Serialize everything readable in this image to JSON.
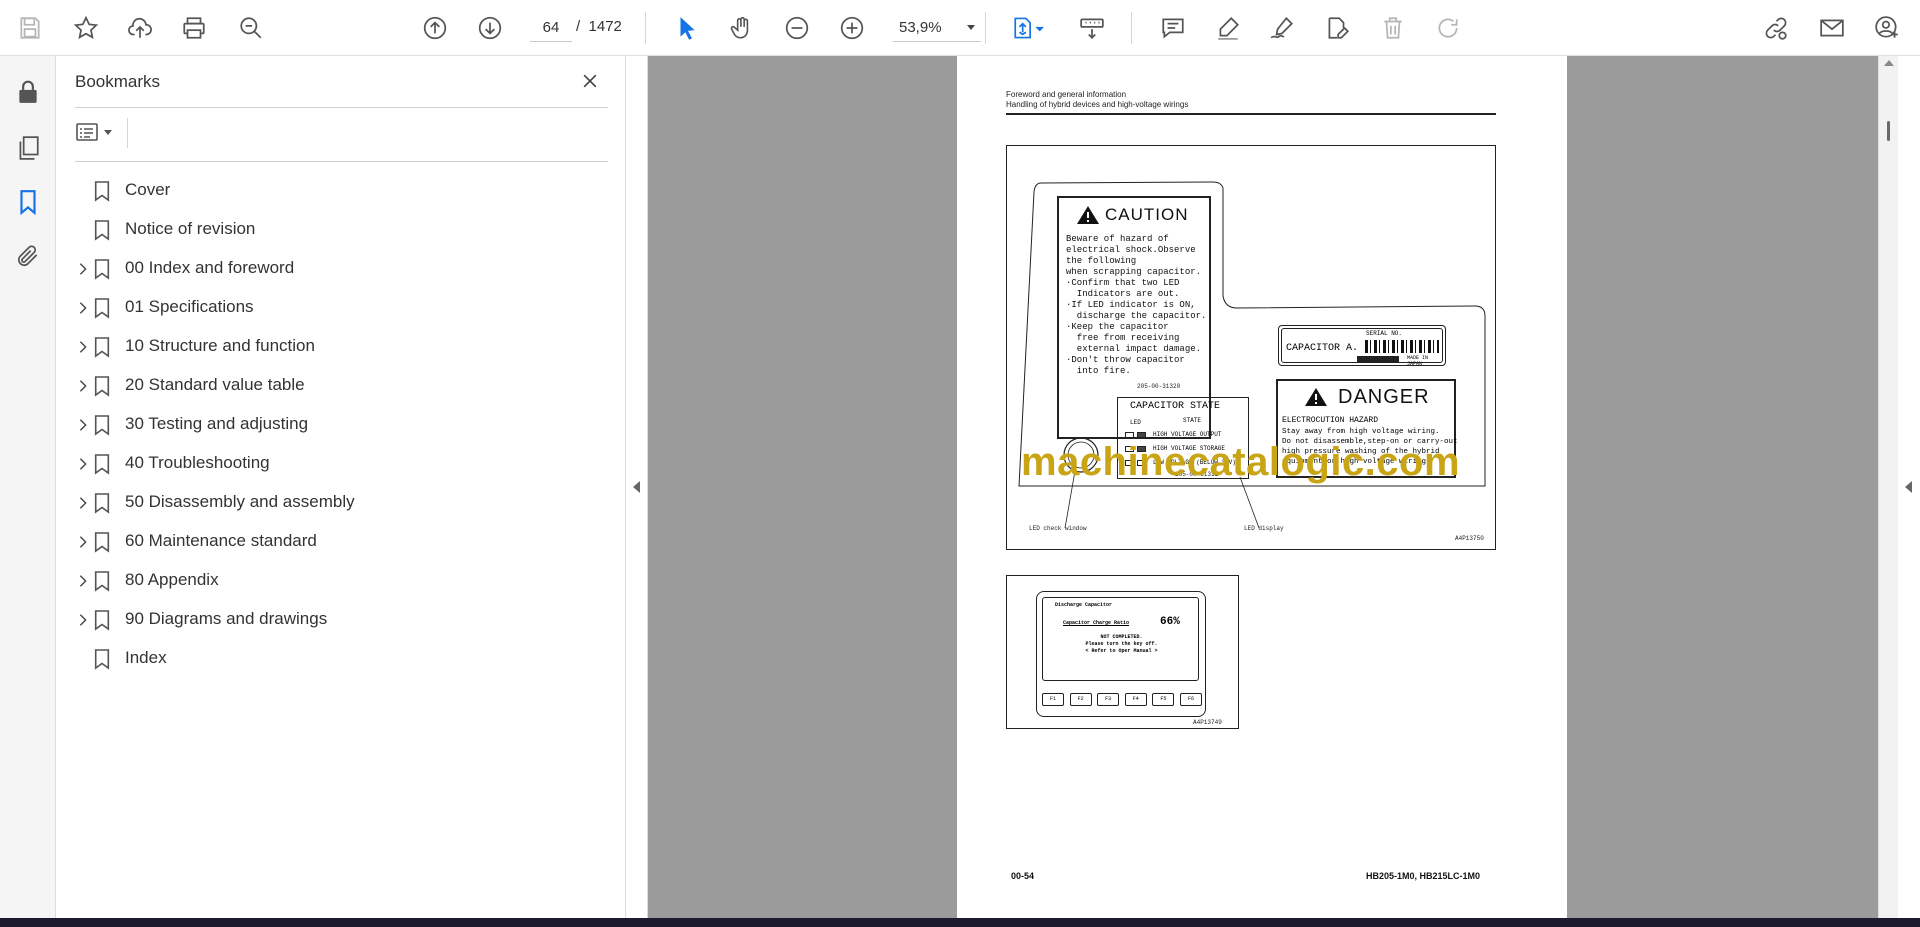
{
  "toolbar": {
    "page_current": "64",
    "page_total": "1472",
    "page_separator": "/",
    "zoom": "53,9%",
    "icons": [
      "save-icon",
      "star-icon",
      "upload-icon",
      "print-icon",
      "search-zoom-icon",
      "page-up-icon",
      "page-down-icon",
      "select-arrow-icon",
      "hand-icon",
      "zoom-out-icon",
      "zoom-in-icon",
      "fit-page-icon",
      "scroll-mode-icon",
      "comment-icon",
      "highlight-icon",
      "sign-icon",
      "edit-doc-icon",
      "delete-icon",
      "redo-icon",
      "share-link-icon",
      "email-icon",
      "account-icon"
    ]
  },
  "left_rail": {
    "icons": [
      "lock-icon",
      "pages-icon",
      "bookmark-icon",
      "attachment-icon"
    ]
  },
  "bookmarks": {
    "title": "Bookmarks",
    "items": [
      {
        "label": "Cover",
        "expandable": false
      },
      {
        "label": "Notice of revision",
        "expandable": false
      },
      {
        "label": "00 Index and foreword",
        "expandable": true
      },
      {
        "label": "01 Specifications",
        "expandable": true
      },
      {
        "label": "10 Structure and function",
        "expandable": true
      },
      {
        "label": "20 Standard value table",
        "expandable": true
      },
      {
        "label": "30 Testing and adjusting",
        "expandable": true
      },
      {
        "label": "40 Troubleshooting",
        "expandable": true
      },
      {
        "label": "50 Disassembly and assembly",
        "expandable": true
      },
      {
        "label": "60 Maintenance standard",
        "expandable": true
      },
      {
        "label": "80 Appendix",
        "expandable": true
      },
      {
        "label": "90 Diagrams and drawings",
        "expandable": true
      },
      {
        "label": "Index",
        "expandable": false
      }
    ]
  },
  "document": {
    "header_line1": "Foreword and general information",
    "header_line2": "Handling of hybrid devices and high-voltage wirings",
    "figure1": {
      "caution_title": "CAUTION",
      "caution_lines": [
        "Beware of hazard of",
        "electrical shock.Observe",
        "the following",
        "when scrapping capacitor.",
        "·Confirm that two LED",
        "  Indicators are out.",
        "·If LED indicator is ON,",
        "  discharge the capacitor.",
        "·Keep the capacitor",
        "  free from receiving",
        "  external impact damage.",
        "·Don't throw capacitor",
        "  into fire."
      ],
      "caution_code": "205-00-31320",
      "serial_label": "SERIAL NO.",
      "capacitor_label": "CAPACITOR A.",
      "made_in": "MADE IN JAPAN",
      "state_title": "CAPACITOR STATE",
      "state_led": "LED",
      "state_state": "STATE",
      "state_rows": [
        "HIGH VOLTAGE OUTPUT",
        "HIGH VOLTAGE STORAGE",
        "LOW VOLTAGE (BELOW 30V)"
      ],
      "state_code": "205-00-31311",
      "danger_title": "DANGER",
      "danger_sub": "ELECTROCUTION HAZARD",
      "danger_lines": [
        "Stay away from high voltage wiring.",
        "Do not disassemble,step-on or carry-out",
        "high pressure washing of the hybrid",
        "equipment or high voltage wiring."
      ],
      "label_led_window": "LED check window",
      "label_led_display": "LED display",
      "code": "A4P13750"
    },
    "figure2": {
      "screen_title": "Discharge Capacitor",
      "ratio_label": "Capacitor Charge Ratio",
      "ratio_value": "66%",
      "msg1": "NOT COMPLETED.",
      "msg2": "Please turn the key off.",
      "msg3": "< Refer to Oper Manual >",
      "keys": [
        "F1",
        "F2",
        "F3",
        "F4",
        "F5",
        "F6"
      ],
      "code": "A4P13749"
    },
    "footer_left": "00-54",
    "footer_right": "HB205-1M0, HB215LC-1M0",
    "watermark": "machinecatalogic.com"
  },
  "colors": {
    "accent": "#1473e6",
    "viewer_bg": "#9b9b9b",
    "watermark": "#c9a516"
  }
}
